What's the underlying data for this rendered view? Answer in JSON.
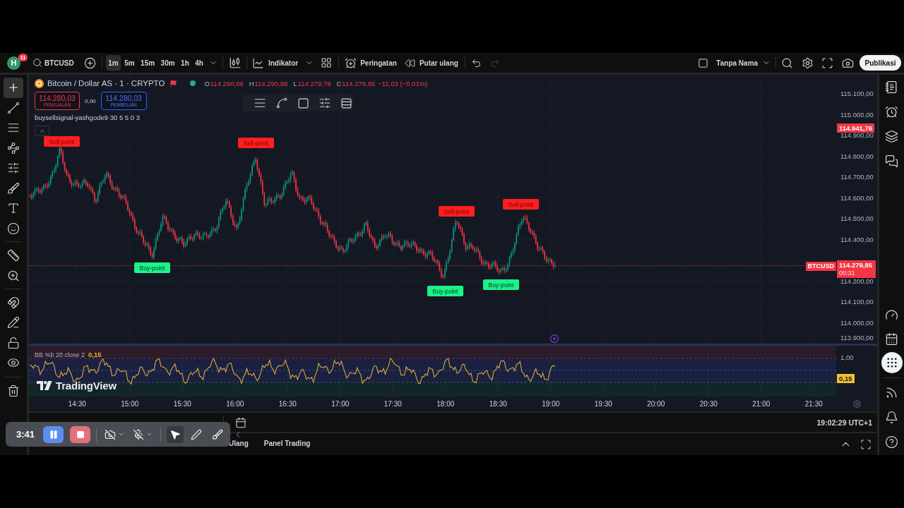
{
  "top_toolbar": {
    "avatar": {
      "letter": "H",
      "badge": "11"
    },
    "symbol": "BTCUSD",
    "intervals": [
      {
        "label": "1m",
        "selected": true
      },
      {
        "label": "5m",
        "selected": false
      },
      {
        "label": "15m",
        "selected": false
      },
      {
        "label": "30m",
        "selected": false
      },
      {
        "label": "1h",
        "selected": false
      },
      {
        "label": "4h",
        "selected": false
      }
    ],
    "indicators_button": "Indikator",
    "alerts_button": "Peringatan",
    "replay_button": "Putar ulang",
    "history": [
      {
        "kind": "undo",
        "disabled": false
      },
      {
        "kind": "redo",
        "disabled": true
      }
    ],
    "layout_name": "Tanpa Nama",
    "publish_button": "Publikasi"
  },
  "left_toolbar": {
    "groups": [
      {
        "tools": [
          {
            "kind": "crosshair",
            "selected": true
          },
          {
            "kind": "trend_line",
            "selected": false
          },
          {
            "kind": "fib",
            "selected": false
          },
          {
            "kind": "pattern",
            "selected": false
          },
          {
            "kind": "forecast",
            "selected": false
          },
          {
            "kind": "brush",
            "selected": false
          },
          {
            "kind": "text",
            "selected": false
          },
          {
            "kind": "emoji",
            "selected": false
          }
        ]
      },
      {
        "tools": [
          {
            "kind": "ruler",
            "selected": false
          },
          {
            "kind": "zoom",
            "selected": false
          }
        ]
      },
      {
        "tools": [
          {
            "kind": "magnet",
            "selected": false
          },
          {
            "kind": "drawing_lock",
            "selected": false
          },
          {
            "kind": "lock",
            "selected": false
          },
          {
            "kind": "visibility",
            "selected": false
          }
        ]
      },
      {
        "tools": [
          {
            "kind": "trash",
            "selected": false
          }
        ]
      }
    ]
  },
  "chart": {
    "legend": {
      "title": "Bitcoin / Dollar AS · 1 · CRYPTO",
      "ohlc": [
        {
          "key": "O",
          "value": "114.290,88"
        },
        {
          "key": "H",
          "value": "114.290,88"
        },
        {
          "key": "L",
          "value": "114.279,79"
        },
        {
          "key": "C",
          "value": "114.279,85"
        }
      ],
      "change": "−11,03 (−0,01%)"
    },
    "sell": {
      "price": "114.280,03",
      "label": "PENJUALAN"
    },
    "spread": "0,00",
    "buy": {
      "price": "114.280,03",
      "label": "PEMBELIAN"
    },
    "indicator_name": "buysellsignal-yashgode9 30 5 5 0 3",
    "signals": [
      {
        "kind": "sell",
        "label": "Sell-point"
      },
      {
        "kind": "buy",
        "label": "Buy-point"
      },
      {
        "kind": "sell",
        "label": "Sell-point"
      },
      {
        "kind": "buy",
        "label": "Buy-point"
      },
      {
        "kind": "sell",
        "label": "Sell-point"
      },
      {
        "kind": "buy",
        "label": "Buy-point"
      },
      {
        "kind": "sell",
        "label": "Sell-point"
      }
    ],
    "price_axis": [
      "115.100,00",
      "115.000,00",
      "114.900,00",
      "114.800,00",
      "114.700,00",
      "114.600,00",
      "114.500,00",
      "114.400,00",
      "114.200,00",
      "114.100,00",
      "114.000,00",
      "113.900,00"
    ],
    "high_price": "114.941,76",
    "last_price": {
      "symbol": "BTCUSD",
      "price": "114.279,85",
      "countdown": "00:31"
    }
  },
  "indicator_pane": {
    "name": "BB %b 20 close 2",
    "value": "0,15",
    "axis_label": "1,00",
    "value_badge": "0,15",
    "watermark": "TradingView"
  },
  "time_axis": [
    "14:30",
    "15:00",
    "15:30",
    "16:00",
    "16:30",
    "17:00",
    "17:30",
    "18:00",
    "18:30",
    "19:00",
    "19:30",
    "20:00",
    "20:30",
    "21:00",
    "21:30"
  ],
  "range_bar": {
    "clock": "19:02:29 UTC+1"
  },
  "bottom_panel": {
    "tabs": [
      {
        "label": "Ulang",
        "selected": false
      },
      {
        "label": "Panel Trading",
        "selected": false
      }
    ]
  },
  "right_sidebar": {
    "top_items": [
      {
        "kind": "watchlist",
        "selected": false
      },
      {
        "kind": "alerts",
        "selected": false
      },
      {
        "kind": "object_tree",
        "selected": false
      },
      {
        "kind": "chats",
        "selected": false
      }
    ],
    "bottom_groups": [
      {
        "items": [
          {
            "kind": "ideas",
            "selected": false
          },
          {
            "kind": "calendar",
            "selected": false
          },
          {
            "kind": "products",
            "selected": true
          }
        ]
      },
      {
        "items": [
          {
            "kind": "streams",
            "selected": false
          },
          {
            "kind": "notifications",
            "selected": false
          },
          {
            "kind": "help",
            "selected": false
          }
        ]
      }
    ]
  },
  "recorder": {
    "elapsed": "3:41",
    "camera_on": false,
    "mic_on": false,
    "tools": [
      {
        "kind": "pointer",
        "selected": true
      },
      {
        "kind": "pen",
        "selected": false
      },
      {
        "kind": "broom",
        "selected": false
      }
    ]
  }
}
